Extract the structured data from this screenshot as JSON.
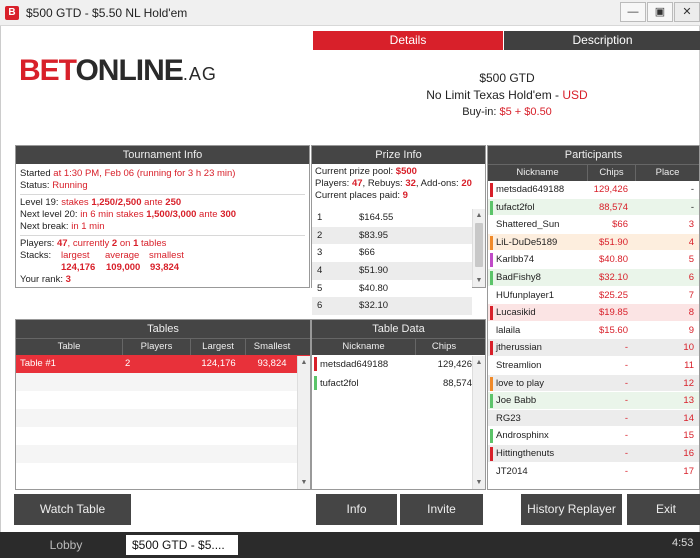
{
  "window": {
    "app_icon": "B",
    "title": "$500 GTD - $5.50 NL Hold'em",
    "minimize_icon": "minimize-icon",
    "restore_icon": "restore-icon",
    "close_icon": "close-icon"
  },
  "logo": {
    "bet": "BET",
    "online": "ONLINE",
    "ag": ".AG"
  },
  "tabs": {
    "details": "Details",
    "description": "Description"
  },
  "details": {
    "name": "$500 GTD",
    "game": "No Limit Texas Hold'em",
    "game_sep": " - ",
    "currency": "USD",
    "buyin_label": "Buy-in:",
    "buyin_value": "$5 + $0.50"
  },
  "tournament_info": {
    "header": "Tournament Info",
    "started_label": "Started",
    "started_value": "at 1:30 PM, Feb 06 (running for 3 h 23 min)",
    "status_label": "Status:",
    "status_value": "Running",
    "level_label": "Level 19:",
    "level_stakes_label": "stakes",
    "level_stakes": "1,250/2,500",
    "level_ante_label": "ante",
    "level_ante": "250",
    "next_level_label": "Next level 20:",
    "next_level_in": "in 6 min",
    "next_level_stakes_label": "stakes",
    "next_level_stakes": "1,500/3,000",
    "next_level_ante_label": "ante",
    "next_level_ante": "300",
    "next_break_label": "Next break:",
    "next_break_value": "in 1 min",
    "players_label": "Players:",
    "players_total": "47",
    "players_currently": ", currently",
    "players_on_count": "2",
    "players_on": "on",
    "players_tables": "1",
    "players_tables_label": "tables",
    "stacks_label": "Stacks:",
    "largest_label": "largest",
    "average_label": "average",
    "smallest_label": "smallest",
    "largest": "124,176",
    "average": "109,000",
    "smallest": "93,824",
    "rank_label": "Your rank:",
    "rank": "3"
  },
  "prize_info": {
    "header": "Prize Info",
    "pool_label": "Current prize pool:",
    "pool": "$500",
    "players_label": "Players:",
    "players": "47",
    "rebuys_label": ", Rebuys:",
    "rebuys": "32",
    "addons_label": ", Add-ons:",
    "addons": "20",
    "places_label": "Current places paid:",
    "places": "9",
    "payouts": [
      {
        "pos": "1",
        "amount": "$164.55"
      },
      {
        "pos": "2",
        "amount": "$83.95"
      },
      {
        "pos": "3",
        "amount": "$66"
      },
      {
        "pos": "4",
        "amount": "$51.90"
      },
      {
        "pos": "5",
        "amount": "$40.80"
      },
      {
        "pos": "6",
        "amount": "$32.10"
      }
    ]
  },
  "tables": {
    "header": "Tables",
    "columns": [
      "Table",
      "Players",
      "Largest",
      "Smallest"
    ],
    "rows": [
      {
        "table": "Table #1",
        "players": "2",
        "largest": "124,176",
        "smallest": "93,824"
      }
    ]
  },
  "table_data": {
    "header": "Table Data",
    "columns": [
      "Nickname",
      "Chips"
    ],
    "rows": [
      {
        "nick": "metsdad649188",
        "chips": "129,426",
        "color": "#d8202a"
      },
      {
        "nick": "tufact2fol",
        "chips": "88,574",
        "color": "#5cc46a"
      }
    ]
  },
  "participants": {
    "header": "Participants",
    "columns": [
      "Nickname",
      "Chips",
      "Place"
    ],
    "rows": [
      {
        "nick": "metsdad649188",
        "chips": "129,426",
        "place": "-",
        "color": "#d8202a",
        "bg": "#ffffff",
        "place_color": "black"
      },
      {
        "nick": "tufact2fol",
        "chips": "88,574",
        "place": "-",
        "color": "#5cc46a",
        "bg": "#eaf5ea",
        "place_color": "black"
      },
      {
        "nick": "Shattered_Sun",
        "chips": "$66",
        "place": "3",
        "color": "",
        "bg": "#ffffff",
        "place_color": "red"
      },
      {
        "nick": "LiL-DuDe5189",
        "chips": "$51.90",
        "place": "4",
        "color": "#f08a2a",
        "bg": "#fdeede",
        "place_color": "red"
      },
      {
        "nick": "Karlbb74",
        "chips": "$40.80",
        "place": "5",
        "color": "#c04cc8",
        "bg": "#ffffff",
        "place_color": "red"
      },
      {
        "nick": "BadFishy8",
        "chips": "$32.10",
        "place": "6",
        "color": "#5cc46a",
        "bg": "#eaf5ea",
        "place_color": "red"
      },
      {
        "nick": "HUfunplayer1",
        "chips": "$25.25",
        "place": "7",
        "color": "",
        "bg": "#ffffff",
        "place_color": "red"
      },
      {
        "nick": "Lucasikid",
        "chips": "$19.85",
        "place": "8",
        "color": "#d8202a",
        "bg": "#fbe4e4",
        "place_color": "red"
      },
      {
        "nick": "lalaila",
        "chips": "$15.60",
        "place": "9",
        "color": "",
        "bg": "#ffffff",
        "place_color": "red"
      },
      {
        "nick": "jtherussian",
        "chips": "-",
        "place": "10",
        "color": "#d8202a",
        "bg": "#ececec",
        "place_color": "red"
      },
      {
        "nick": "Streamlion",
        "chips": "-",
        "place": "11",
        "color": "",
        "bg": "#ffffff",
        "place_color": "red"
      },
      {
        "nick": "love to play",
        "chips": "-",
        "place": "12",
        "color": "#f08a2a",
        "bg": "#ececec",
        "place_color": "red"
      },
      {
        "nick": "Joe Babb",
        "chips": "-",
        "place": "13",
        "color": "#5cc46a",
        "bg": "#eaf5ea",
        "place_color": "red"
      },
      {
        "nick": "RG23",
        "chips": "-",
        "place": "14",
        "color": "",
        "bg": "#ececec",
        "place_color": "red"
      },
      {
        "nick": "Androsphinx",
        "chips": "-",
        "place": "15",
        "color": "#5cc46a",
        "bg": "#ffffff",
        "place_color": "red"
      },
      {
        "nick": "Hittingthenuts",
        "chips": "-",
        "place": "16",
        "color": "#d8202a",
        "bg": "#ececec",
        "place_color": "red"
      },
      {
        "nick": "JT2014",
        "chips": "-",
        "place": "17",
        "color": "",
        "bg": "#ffffff",
        "place_color": "red"
      }
    ]
  },
  "buttons": {
    "watch_table": "Watch Table",
    "info": "Info",
    "invite": "Invite",
    "history": "History Replayer",
    "exit": "Exit"
  },
  "taskbar": {
    "lobby": "Lobby",
    "active_tab": "$500 GTD - $5....",
    "clock": "4:53"
  },
  "colors": {
    "accent": "#d8202a",
    "dark_header": "#454545"
  }
}
